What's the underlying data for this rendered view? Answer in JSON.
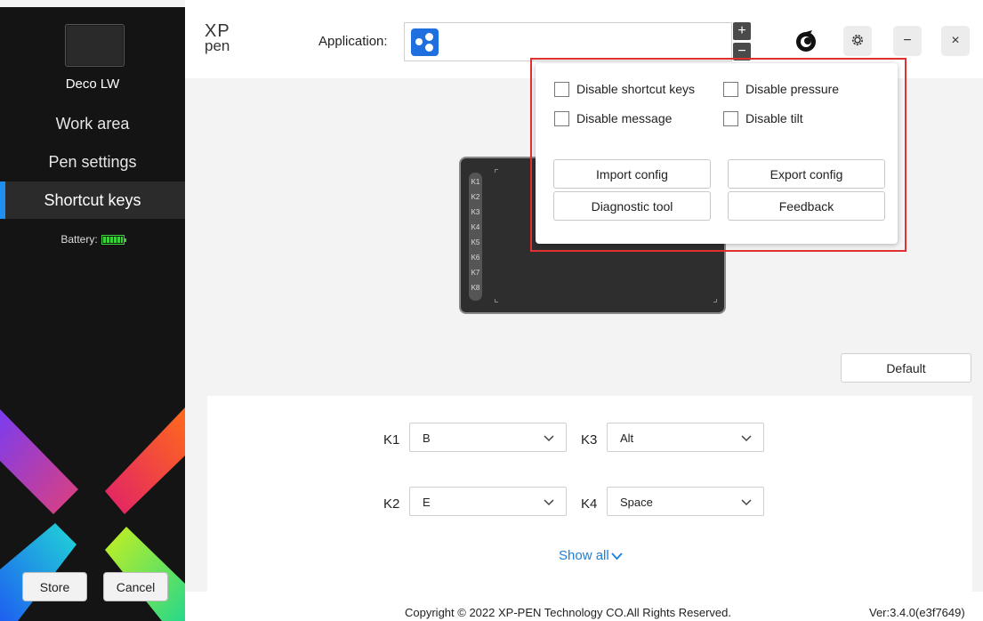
{
  "sidebar": {
    "device_name": "Deco LW",
    "nav": [
      {
        "label": "Work area"
      },
      {
        "label": "Pen settings"
      },
      {
        "label": "Shortcut keys",
        "active": true
      }
    ],
    "battery_label": "Battery:",
    "store_label": "Store",
    "cancel_label": "Cancel"
  },
  "header": {
    "logo_top": "XP",
    "logo_bottom": "pen",
    "application_label": "Application:",
    "plus": "+",
    "minus": "−",
    "minimize": "−",
    "close": "×"
  },
  "popup": {
    "disable_shortcut_keys": "Disable shortcut keys",
    "disable_pressure": "Disable pressure",
    "disable_message": "Disable message",
    "disable_tilt": "Disable tilt",
    "import_config": "Import config",
    "export_config": "Export config",
    "diagnostic_tool": "Diagnostic tool",
    "feedback": "Feedback"
  },
  "tablet": {
    "keys": [
      "K1",
      "K2",
      "K3",
      "K4",
      "K5",
      "K6",
      "K7",
      "K8"
    ]
  },
  "main": {
    "default_label": "Default",
    "keys": [
      {
        "label": "K1",
        "value": "B"
      },
      {
        "label": "K3",
        "value": "Alt"
      },
      {
        "label": "K2",
        "value": "E"
      },
      {
        "label": "K4",
        "value": "Space"
      }
    ],
    "show_all": "Show all"
  },
  "footer": {
    "copyright": "Copyright © 2022  XP-PEN Technology CO.All Rights Reserved.",
    "version": "Ver:3.4.0(e3f7649)"
  },
  "colors": {
    "accent": "#1e8ff0",
    "link": "#1e7fd8",
    "highlight": "#e03030",
    "battery": "#39d339"
  }
}
